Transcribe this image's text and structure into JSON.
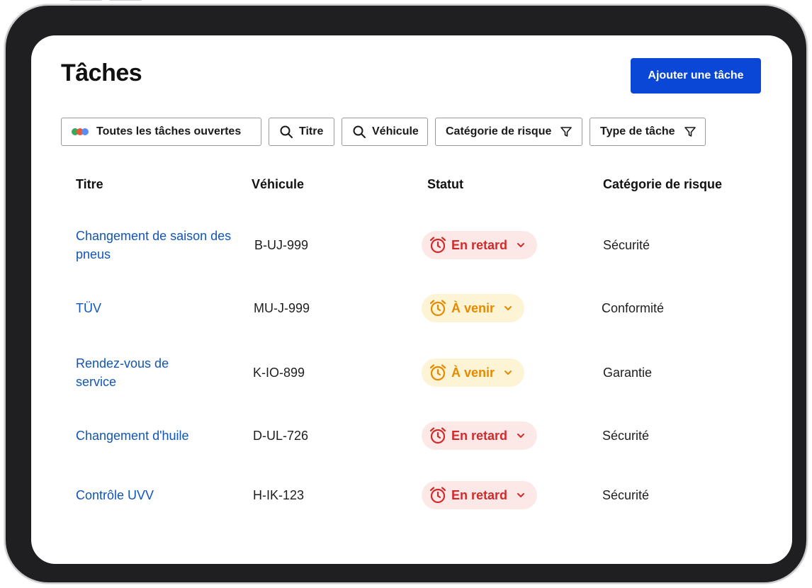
{
  "page": {
    "title": "Tâches",
    "add_button_label": "Ajouter une tâche"
  },
  "filters": [
    {
      "label": "Toutes les tâches ouvertes",
      "icon": "multicolor-dots-icon"
    },
    {
      "label": "Titre",
      "icon": "search-icon"
    },
    {
      "label": "Véhicule",
      "icon": "search-icon"
    },
    {
      "label": "Catégorie de risque",
      "icon": "filter-icon"
    },
    {
      "label": "Type de tâche",
      "icon": "filter-icon"
    }
  ],
  "dot_colors": [
    "#3aa75a",
    "#e55a3c",
    "#5b8def"
  ],
  "table": {
    "columns": [
      "Titre",
      "Véhicule",
      "Statut",
      "Catégorie de risque"
    ],
    "rows": [
      {
        "title": "Changement de saison des pneus",
        "vehicle": "B-UJ-999",
        "status": "En retard",
        "status_type": "overdue",
        "risk": "Sécurité"
      },
      {
        "title": "TÜV",
        "vehicle": "MU-J-999",
        "status": "À venir",
        "status_type": "upcoming",
        "risk": "Conformité"
      },
      {
        "title": "Rendez-vous de service",
        "vehicle": "K-IO-899",
        "status": "À venir",
        "status_type": "upcoming",
        "risk": "Garantie"
      },
      {
        "title": "Changement d'huile",
        "vehicle": "D-UL-726",
        "status": "En retard",
        "status_type": "overdue",
        "risk": "Sécurité"
      },
      {
        "title": "Contrôle UVV",
        "vehicle": "H-IK-123",
        "status": "En retard",
        "status_type": "overdue",
        "risk": "Sécurité"
      }
    ]
  },
  "colors": {
    "accent": "#0a47d6",
    "link": "#1155b8",
    "overdue_bg": "#fde8e8",
    "overdue_fg": "#d12a2a",
    "upcoming_bg": "#fdf3d5",
    "upcoming_fg": "#e58a00"
  }
}
